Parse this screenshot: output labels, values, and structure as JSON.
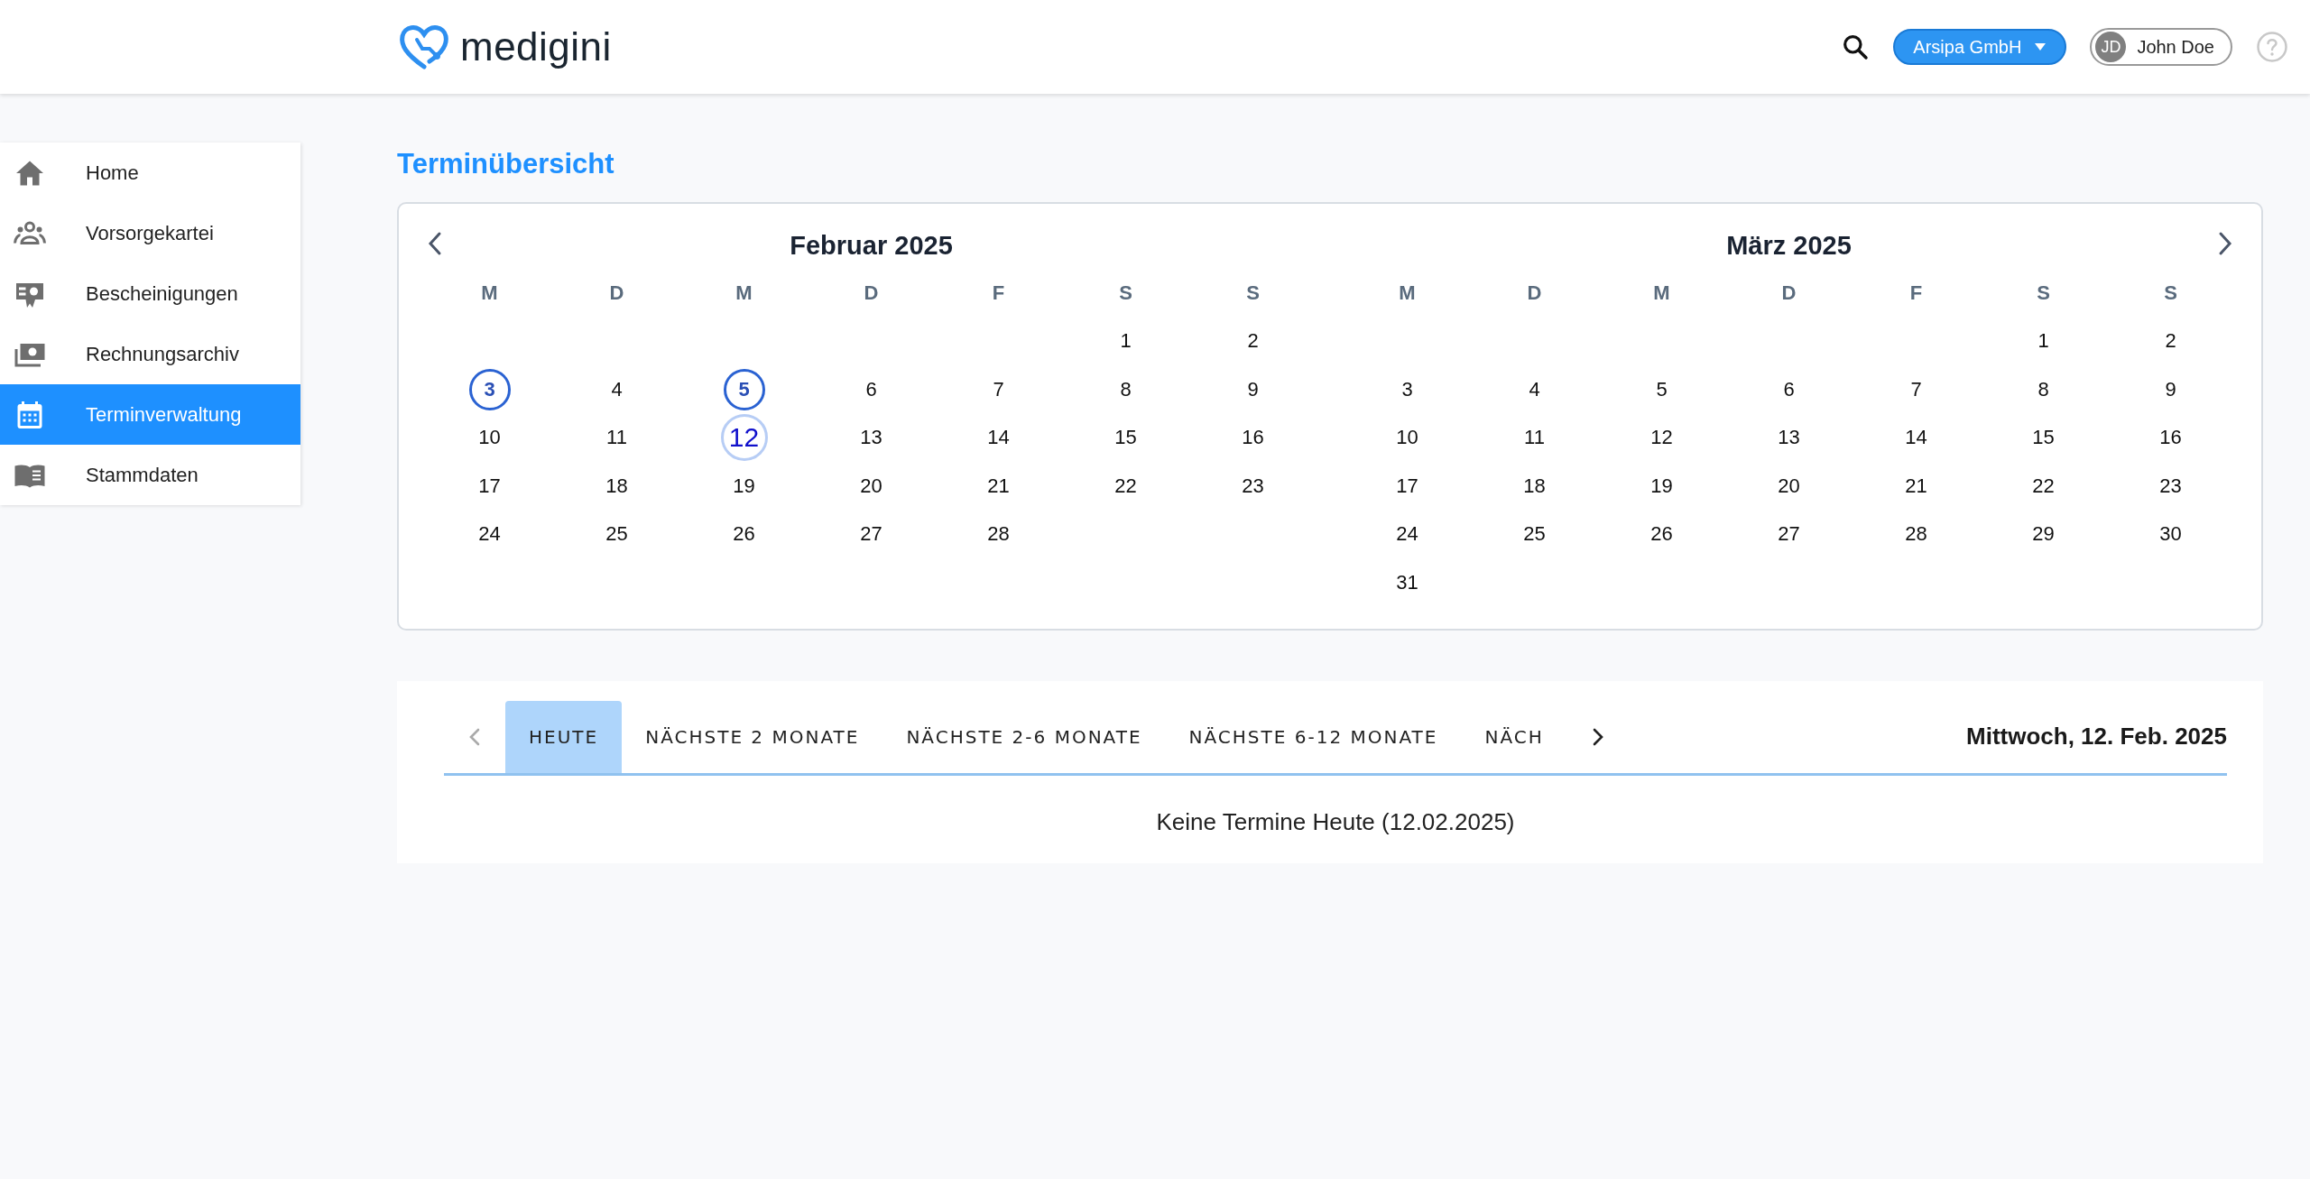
{
  "header": {
    "logo_text": "medigini",
    "company": "Arsipa GmbH",
    "user": {
      "initials": "JD",
      "name": "John Doe"
    }
  },
  "sidebar": {
    "items": [
      {
        "label": "Home",
        "selected": false
      },
      {
        "label": "Vorsorgekartei",
        "selected": false
      },
      {
        "label": "Bescheinigungen",
        "selected": false
      },
      {
        "label": "Rechnungsarchiv",
        "selected": false
      },
      {
        "label": "Terminverwaltung",
        "selected": true
      },
      {
        "label": "Stammdaten",
        "selected": false
      }
    ]
  },
  "page_title": "Terminübersicht",
  "calendar": {
    "months": [
      {
        "title": "Februar 2025",
        "weekdays": [
          "M",
          "D",
          "M",
          "D",
          "F",
          "S",
          "S"
        ],
        "weeks": [
          [
            {
              "t": "1",
              "marked": false,
              "today": false
            },
            {
              "t": "2",
              "marked": false,
              "today": false
            }
          ],
          [
            {
              "t": "3",
              "marked": true,
              "today": false
            },
            {
              "t": "4",
              "marked": false,
              "today": false
            },
            {
              "t": "5",
              "marked": true,
              "today": false
            },
            {
              "t": "6",
              "marked": false,
              "today": false
            },
            {
              "t": "7",
              "marked": false,
              "today": false
            },
            {
              "t": "8",
              "marked": false,
              "today": false
            },
            {
              "t": "9",
              "marked": false,
              "today": false
            }
          ],
          [
            {
              "t": "10",
              "marked": false,
              "today": false
            },
            {
              "t": "11",
              "marked": false,
              "today": false
            },
            {
              "t": "12",
              "marked": false,
              "today": true
            },
            {
              "t": "13",
              "marked": false,
              "today": false
            },
            {
              "t": "14",
              "marked": false,
              "today": false
            },
            {
              "t": "15",
              "marked": false,
              "today": false
            },
            {
              "t": "16",
              "marked": false,
              "today": false
            }
          ],
          [
            {
              "t": "17",
              "marked": false,
              "today": false
            },
            {
              "t": "18",
              "marked": false,
              "today": false
            },
            {
              "t": "19",
              "marked": false,
              "today": false
            },
            {
              "t": "20",
              "marked": false,
              "today": false
            },
            {
              "t": "21",
              "marked": false,
              "today": false
            },
            {
              "t": "22",
              "marked": false,
              "today": false
            },
            {
              "t": "23",
              "marked": false,
              "today": false
            }
          ],
          [
            {
              "t": "24",
              "marked": false,
              "today": false
            },
            {
              "t": "25",
              "marked": false,
              "today": false
            },
            {
              "t": "26",
              "marked": false,
              "today": false
            },
            {
              "t": "27",
              "marked": false,
              "today": false
            },
            {
              "t": "28",
              "marked": false,
              "today": false
            }
          ]
        ]
      },
      {
        "title": "März 2025",
        "weekdays": [
          "M",
          "D",
          "M",
          "D",
          "F",
          "S",
          "S"
        ],
        "weeks": [
          [
            {
              "t": "1",
              "marked": false,
              "today": false
            },
            {
              "t": "2",
              "marked": false,
              "today": false
            }
          ],
          [
            {
              "t": "3",
              "marked": false,
              "today": false
            },
            {
              "t": "4",
              "marked": false,
              "today": false
            },
            {
              "t": "5",
              "marked": false,
              "today": false
            },
            {
              "t": "6",
              "marked": false,
              "today": false
            },
            {
              "t": "7",
              "marked": false,
              "today": false
            },
            {
              "t": "8",
              "marked": false,
              "today": false
            },
            {
              "t": "9",
              "marked": false,
              "today": false
            }
          ],
          [
            {
              "t": "10",
              "marked": false,
              "today": false
            },
            {
              "t": "11",
              "marked": false,
              "today": false
            },
            {
              "t": "12",
              "marked": false,
              "today": false
            },
            {
              "t": "13",
              "marked": false,
              "today": false
            },
            {
              "t": "14",
              "marked": false,
              "today": false
            },
            {
              "t": "15",
              "marked": false,
              "today": false
            },
            {
              "t": "16",
              "marked": false,
              "today": false
            }
          ],
          [
            {
              "t": "17",
              "marked": false,
              "today": false
            },
            {
              "t": "18",
              "marked": false,
              "today": false
            },
            {
              "t": "19",
              "marked": false,
              "today": false
            },
            {
              "t": "20",
              "marked": false,
              "today": false
            },
            {
              "t": "21",
              "marked": false,
              "today": false
            },
            {
              "t": "22",
              "marked": false,
              "today": false
            },
            {
              "t": "23",
              "marked": false,
              "today": false
            }
          ],
          [
            {
              "t": "24",
              "marked": false,
              "today": false
            },
            {
              "t": "25",
              "marked": false,
              "today": false
            },
            {
              "t": "26",
              "marked": false,
              "today": false
            },
            {
              "t": "27",
              "marked": false,
              "today": false
            },
            {
              "t": "28",
              "marked": false,
              "today": false
            },
            {
              "t": "29",
              "marked": false,
              "today": false
            },
            {
              "t": "30",
              "marked": false,
              "today": false
            }
          ],
          [
            {
              "t": "31",
              "marked": false,
              "today": false
            }
          ]
        ]
      }
    ]
  },
  "appointments": {
    "tabs_prev": {
      "disabled": true
    },
    "tabs_next": {
      "disabled": false
    },
    "tabs": [
      {
        "label": "HEUTE",
        "selected": true
      },
      {
        "label": "NÄCHSTE 2 MONATE",
        "selected": false
      },
      {
        "label": "NÄCHSTE 2-6 MONATE",
        "selected": false
      },
      {
        "label": "NÄCHSTE 6-12 MONATE",
        "selected": false
      },
      {
        "label": "NÄCH",
        "selected": false
      }
    ],
    "current_date": "Mittwoch, 12. Feb. 2025",
    "empty_message": "Keine Termine Heute (12.02.2025)"
  }
}
